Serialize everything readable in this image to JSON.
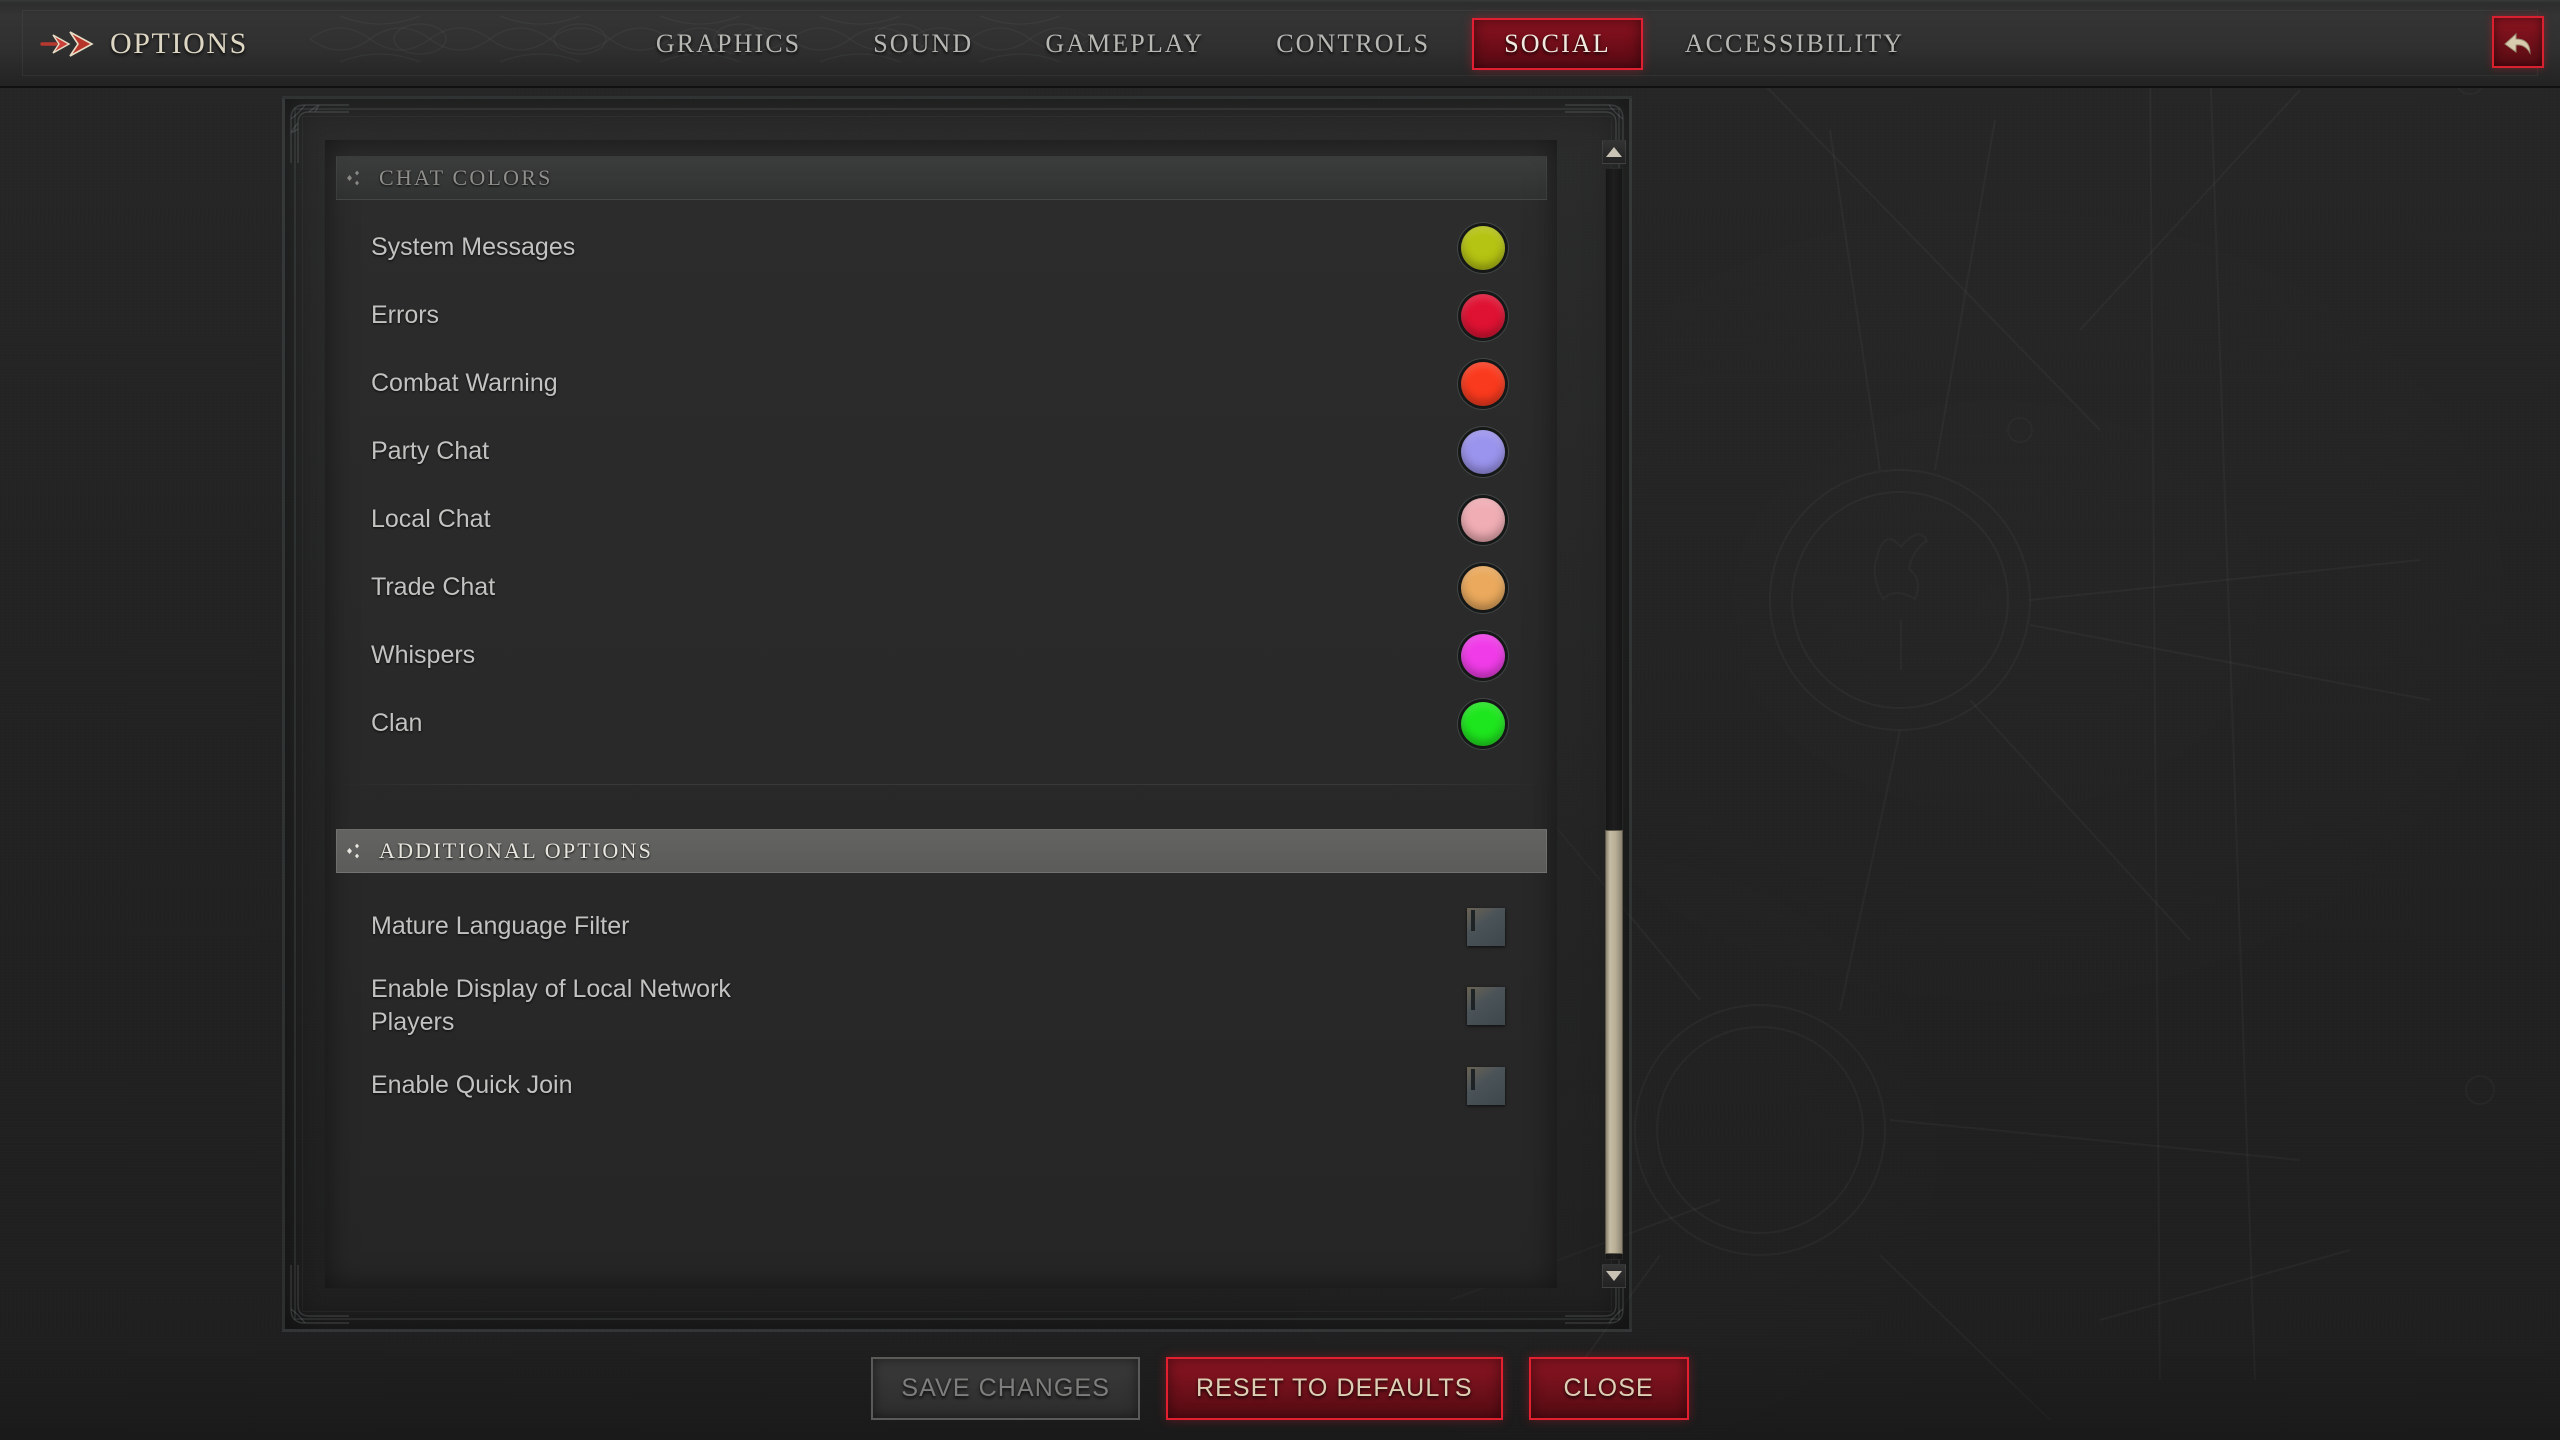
{
  "header": {
    "title": "OPTIONS",
    "arrow_icon": "double-arrow-icon",
    "back_icon": "back-arrow-icon",
    "tabs": [
      {
        "label": "GRAPHICS",
        "active": false
      },
      {
        "label": "SOUND",
        "active": false
      },
      {
        "label": "GAMEPLAY",
        "active": false
      },
      {
        "label": "CONTROLS",
        "active": false
      },
      {
        "label": "SOCIAL",
        "active": true
      },
      {
        "label": "ACCESSIBILITY",
        "active": false
      }
    ]
  },
  "sections": [
    {
      "title": "CHAT COLORS",
      "icon": "diamond-cluster-icon",
      "highlighted": false,
      "rows": [
        {
          "label": "System Messages",
          "type": "swatch",
          "color": "#b5c312"
        },
        {
          "label": "Errors",
          "type": "swatch",
          "color": "#e01233"
        },
        {
          "label": "Combat Warning",
          "type": "swatch",
          "color": "#fa3a1e"
        },
        {
          "label": "Party Chat",
          "type": "swatch",
          "color": "#9b94ee"
        },
        {
          "label": "Local Chat",
          "type": "swatch",
          "color": "#f0adb4"
        },
        {
          "label": "Trade Chat",
          "type": "swatch",
          "color": "#eaa95c"
        },
        {
          "label": "Whispers",
          "type": "swatch",
          "color": "#f03ce8"
        },
        {
          "label": "Clan",
          "type": "swatch",
          "color": "#1ee61e"
        }
      ]
    },
    {
      "title": "ADDITIONAL OPTIONS",
      "icon": "diamond-cluster-icon",
      "highlighted": true,
      "rows": [
        {
          "label": "Mature Language Filter",
          "type": "checkbox",
          "checked": false
        },
        {
          "label": "Enable Display of Local Network Players",
          "type": "checkbox",
          "checked": true
        },
        {
          "label": "Enable Quick Join",
          "type": "checkbox",
          "checked": true
        }
      ]
    }
  ],
  "scrollbar": {
    "up_icon": "chevron-up-icon",
    "down_icon": "chevron-down-icon",
    "thumb_top_pct": 60,
    "thumb_height_pct": 37
  },
  "footer": {
    "buttons": [
      {
        "label": "SAVE CHANGES",
        "style": "disabled"
      },
      {
        "label": "RESET TO DEFAULTS",
        "style": "danger"
      },
      {
        "label": "CLOSE",
        "style": "danger"
      }
    ]
  },
  "theme": {
    "accent_red": "#e01f32",
    "accent_red_fill": "#6e0d18",
    "tan": "#dccfb4",
    "text": "#c2c2c0",
    "panel_bg": "#292929"
  }
}
